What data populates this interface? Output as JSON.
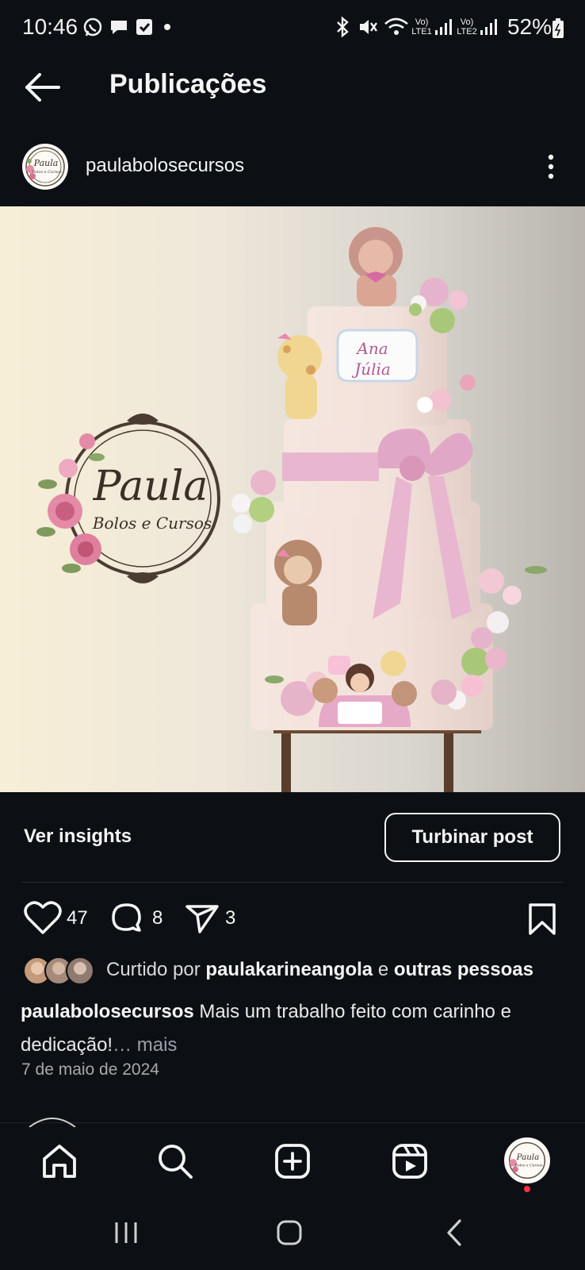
{
  "status_bar": {
    "time": "10:46",
    "battery": "52%",
    "sim1_label": "LTE1",
    "sim2_label": "LTE2",
    "volte1": "Vo)",
    "volte2": "Vo)"
  },
  "header": {
    "title": "Publicações",
    "back_icon": "arrow-left-icon"
  },
  "post": {
    "username": "paulabolosecursos",
    "avatar_text_line1": "Paula",
    "avatar_text_line2": "Bolos e Cursos",
    "image": {
      "logo_title": "Paula",
      "logo_subtitle": "Bolos e Cursos",
      "plaque_line1": "Ana",
      "plaque_line2": "Júlia"
    },
    "insights_label": "Ver insights",
    "boost_label": "Turbinar post",
    "likes_count": "47",
    "comments_count": "8",
    "shares_count": "3",
    "liked_by_prefix": "Curtido por",
    "liked_by_user": "paulakarineangola",
    "liked_by_conj": "e",
    "liked_by_others": "outras pessoas",
    "caption_user": "paulabolosecursos",
    "caption_text": "Mais um trabalho feito com carinho e dedicação!",
    "caption_more": "… mais",
    "date": "7 de maio de 2024"
  },
  "bottom_nav": {
    "items": [
      "home-icon",
      "search-icon",
      "create-icon",
      "reels-icon",
      "profile-avatar"
    ]
  },
  "colors": {
    "background": "#0c1014",
    "text": "#f5f5f5",
    "notification_dot": "#ff3040",
    "cake_pink": "#e8b6cf"
  }
}
